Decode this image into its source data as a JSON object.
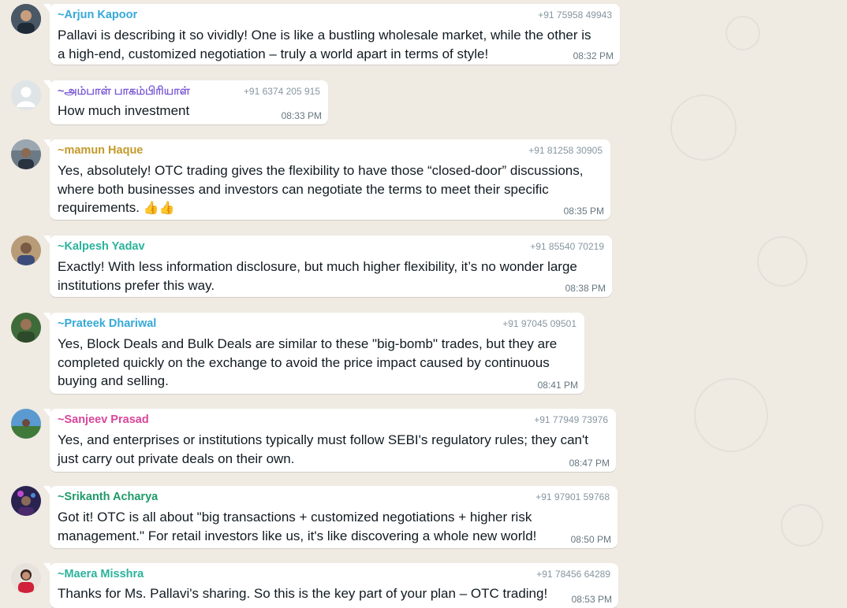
{
  "colors": {
    "chat_background": "#efeae2",
    "bubble": "#ffffff",
    "phone_text": "#8696a0",
    "time_text": "#667781"
  },
  "messages": [
    {
      "sender": "~Arjun Kapoor",
      "sender_color": "#35a8d8",
      "phone": "+91 75958 49943",
      "text": "Pallavi is describing it so vividly! One is like a bustling wholesale market, while the other is\na high-end, customized negotiation – truly a world apart in terms of style!",
      "time": "08:32 PM",
      "avatar_icon": "user-photo-avatar"
    },
    {
      "sender": "~அம்பாள் பாகம்பிரியாள்",
      "sender_color": "#7c5cd6",
      "phone": "+91 6374 205 915",
      "text": "How much investment",
      "time": "08:33 PM",
      "avatar_icon": "default-person-avatar"
    },
    {
      "sender": "~mamun Haque",
      "sender_color": "#c39a2b",
      "phone": "+91 81258 30905",
      "text": "Yes, absolutely! OTC trading gives the flexibility to have those “closed-door” discussions,\nwhere both businesses and investors can negotiate the terms to meet their specific\nrequirements.",
      "emoji": "👍👍",
      "time": "08:35 PM",
      "avatar_icon": "user-photo-avatar"
    },
    {
      "sender": "~Kalpesh Yadav",
      "sender_color": "#2bb39b",
      "phone": "+91 85540 70219",
      "text": "Exactly! With less information disclosure, but much higher flexibility, it’s no wonder large\ninstitutions prefer this way.",
      "time": "08:38 PM",
      "avatar_icon": "user-photo-avatar"
    },
    {
      "sender": "~Prateek Dhariwal",
      "sender_color": "#35a8d8",
      "phone": "+91 97045 09501",
      "text": "Yes, Block Deals and Bulk Deals are similar to these \"big-bomb\" trades, but they are\ncompleted quickly on the exchange to avoid the price impact caused by continuous\nbuying and selling.",
      "time": "08:41 PM",
      "avatar_icon": "user-photo-avatar"
    },
    {
      "sender": "~Sanjeev Prasad",
      "sender_color": "#d9469a",
      "phone": "+91 77949 73976",
      "text": "Yes, and enterprises or institutions typically must follow SEBI's regulatory rules; they can't\njust carry out private deals on their own.",
      "time": "08:47 PM",
      "avatar_icon": "user-photo-avatar"
    },
    {
      "sender": "~Srikanth Acharya",
      "sender_color": "#1f9a6a",
      "phone": "+91 97901 59768",
      "text": "Got it! OTC is all about \"big transactions + customized negotiations + higher risk\nmanagement.\" For retail investors like us, it's like discovering a whole new world!",
      "time": "08:50 PM",
      "avatar_icon": "user-photo-avatar"
    },
    {
      "sender": "~Maera Misshra",
      "sender_color": "#2bb39b",
      "phone": "+91 78456 64289",
      "text": "Thanks for Ms. Pallavi's sharing. So this is the key part of your plan – OTC trading!",
      "time": "08:53 PM",
      "avatar_icon": "user-photo-avatar"
    }
  ]
}
